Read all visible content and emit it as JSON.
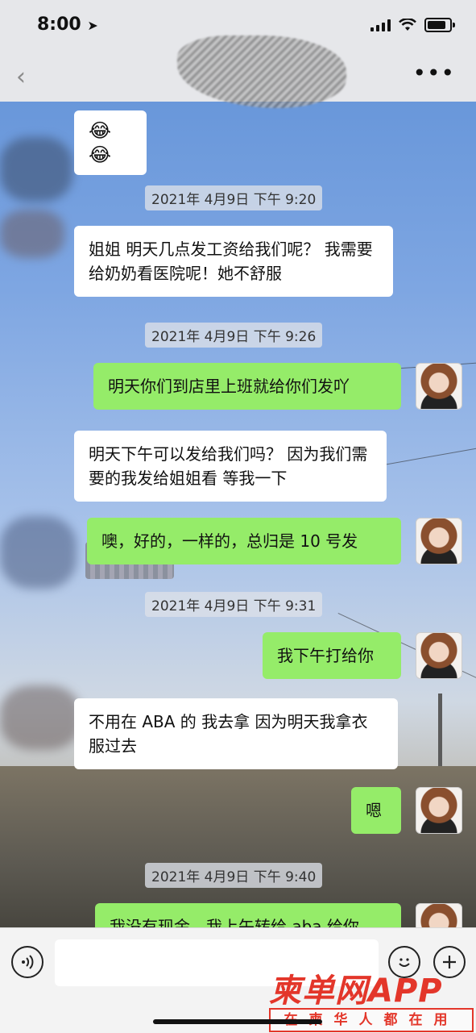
{
  "status": {
    "time": "8:00",
    "location_icon": "location-arrow-icon"
  },
  "nav": {
    "back_icon": "chevron-left-icon",
    "more_label": "•••"
  },
  "messages": [
    {
      "kind": "in",
      "text": "😂😂"
    },
    {
      "kind": "timestamp",
      "text": "2021年 4月9日 下午 9:20"
    },
    {
      "kind": "in",
      "text": "姐姐 明天几点发工资给我们呢？ 我需要给奶奶看医院呢！她不舒服"
    },
    {
      "kind": "timestamp",
      "text": "2021年 4月9日 下午 9:26"
    },
    {
      "kind": "out",
      "text": "明天你们到店里上班就给你们发吖"
    },
    {
      "kind": "in",
      "text": "明天下午可以发给我们吗？ 因为我们需要的我发给姐姐看 等我一下"
    },
    {
      "kind": "out",
      "text": "噢，好的，一样的，总归是 10 号发"
    },
    {
      "kind": "timestamp",
      "text": "2021年 4月9日 下午 9:31"
    },
    {
      "kind": "out",
      "text": "我下午打给你"
    },
    {
      "kind": "in",
      "text": "不用在 ABA 的 我去拿 因为明天我拿衣服过去"
    },
    {
      "kind": "out",
      "text": "嗯"
    },
    {
      "kind": "timestamp",
      "text": "2021年 4月9日 下午 9:40"
    },
    {
      "kind": "out",
      "text": "我没有现金，我上午转给 aba 给你"
    }
  ],
  "input": {
    "voice_icon": "voice-icon",
    "emoji_icon": "emoji-icon",
    "plus_icon": "plus-icon",
    "text_value": ""
  },
  "watermark": {
    "title": "柬单网APP",
    "subtitle": "在柬华人都在用"
  },
  "colors": {
    "incoming": "#ffffff",
    "outgoing": "#95ec69",
    "watermark": "#e3362a"
  }
}
